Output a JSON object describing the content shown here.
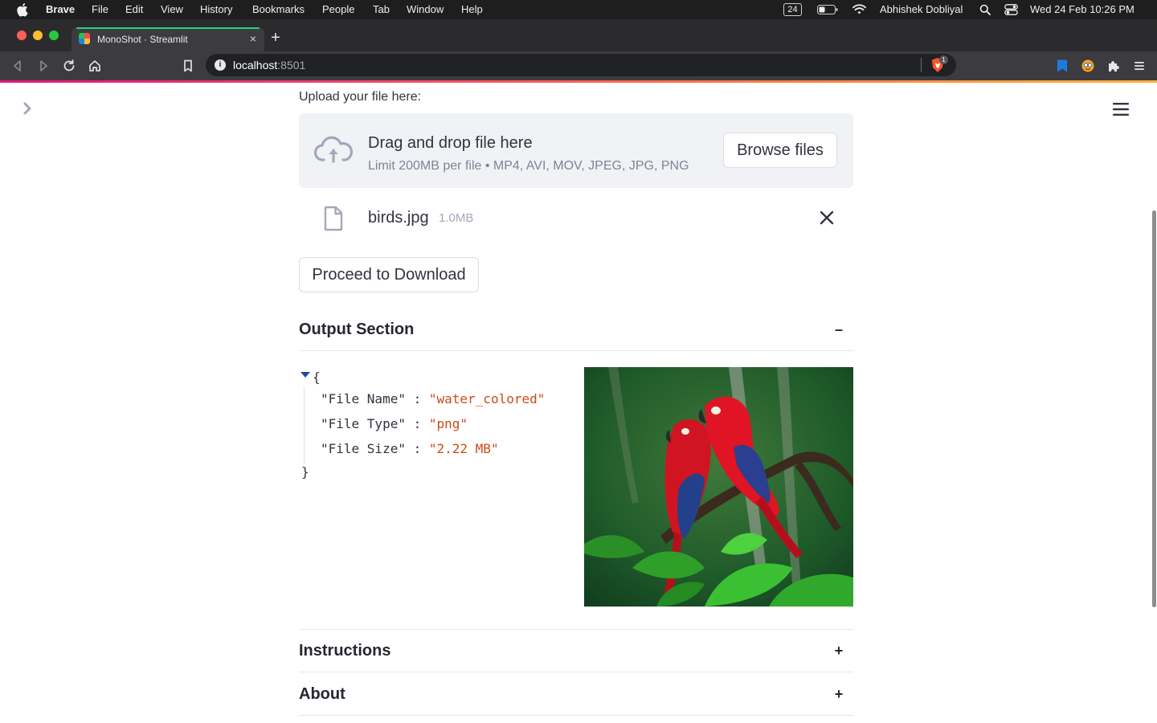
{
  "menubar": {
    "app": "Brave",
    "items": [
      "File",
      "Edit",
      "View",
      "History",
      "Bookmarks",
      "People",
      "Tab",
      "Window",
      "Help"
    ],
    "battery_badge": "24",
    "user": "Abhishek Dobliyal",
    "datetime": "Wed 24 Feb  10:26 PM"
  },
  "browser": {
    "tab_title": "MonoShot · Streamlit",
    "tab_close": "×",
    "new_tab": "+",
    "url_host": "localhost",
    "url_port": ":8501",
    "shield_count": "1",
    "info_icon": "i"
  },
  "uploader": {
    "label": "Upload your file here:",
    "drop_title": "Drag and drop file here",
    "limit_text": "Limit 200MB per file • MP4, AVI, MOV, JPEG, JPG, PNG",
    "browse_label": "Browse files",
    "file_name": "birds.jpg",
    "file_size": "1.0MB"
  },
  "proceed_label": "Proceed to Download",
  "output_section": {
    "title": "Output Section",
    "toggle": "–",
    "json": {
      "open": "{",
      "close": "}",
      "rows": [
        {
          "key": "\"File Name\"",
          "colon": " : ",
          "value": "\"water_colored\""
        },
        {
          "key": "\"File Type\"",
          "colon": " : ",
          "value": "\"png\""
        },
        {
          "key": "\"File Size\"",
          "colon": " : ",
          "value": "\"2.22 MB\""
        }
      ]
    }
  },
  "instructions": {
    "title": "Instructions",
    "toggle": "+"
  },
  "about": {
    "title": "About",
    "toggle": "+"
  },
  "colors": {
    "accent": "#ff4b4b",
    "json_value": "#cb4b16",
    "dropzone_bg": "#f0f2f6",
    "text": "#31333f"
  },
  "icons": {
    "sidebar_toggle": "chevron-right-icon",
    "app_menu": "hamburger-menu-icon",
    "upload": "cloud-upload-icon",
    "file": "file-icon",
    "remove": "close-icon"
  }
}
